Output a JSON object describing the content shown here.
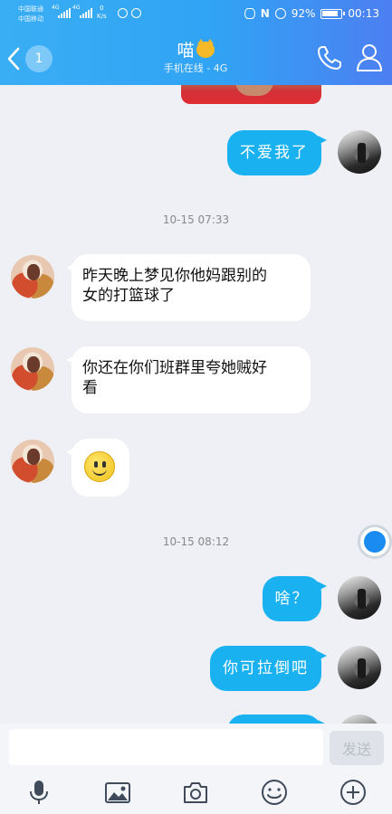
{
  "status_bar": {
    "carrier_1": "中国联通",
    "carrier_2": "中国移动",
    "net_1": "4G",
    "net_2": "4G",
    "speed_value": "0",
    "speed_unit": "K/s",
    "battery": "92%",
    "time": "00:13"
  },
  "header": {
    "unread_count": "1",
    "contact_name": "喵",
    "status": "手机在线 - 4G",
    "icons": {
      "back": "chevron-left-icon",
      "call": "phone-icon",
      "profile": "person-icon"
    }
  },
  "messages": {
    "m1": {
      "text": "不爱我了"
    },
    "ts1": "10-15 07:33",
    "m2": {
      "line1": "昨天晚上梦见你他妈跟别的",
      "line2": "女的打篮球了"
    },
    "m3": {
      "line1": "你还在你们班群里夸她贼好",
      "line2": "看"
    },
    "m4": {
      "emoji": "smiley-icon"
    },
    "ts2": "10-15 08:12",
    "m5": {
      "text": "啥？"
    },
    "m6": {
      "text": "你可拉倒吧"
    }
  },
  "input": {
    "value": "",
    "placeholder": "",
    "send_label": "发送"
  },
  "toolbar": {
    "items": [
      "microphone-icon",
      "image-icon",
      "camera-icon",
      "emoji-icon",
      "plus-icon"
    ]
  },
  "colors": {
    "header_start": "#3aaef4",
    "header_end": "#4d7ff2",
    "my_bubble": "#1ab1f1",
    "their_bubble": "#ffffff",
    "chat_background": "#eef0f6"
  }
}
